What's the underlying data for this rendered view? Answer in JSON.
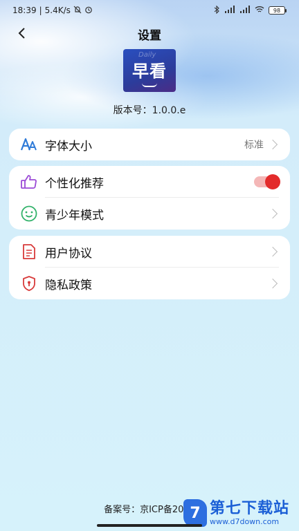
{
  "status_bar": {
    "time": "18:39",
    "speed": "5.4K/s",
    "battery": "98"
  },
  "nav": {
    "title": "设置"
  },
  "logo": {
    "small_text": "Daily",
    "name": "早看"
  },
  "version_text": "版本号：1.0.0.e",
  "settings": {
    "font_size": {
      "label": "字体大小",
      "value": "标准",
      "icon": "font-size-icon"
    },
    "personalized": {
      "label": "个性化推荐",
      "icon": "thumbs-up-icon",
      "enabled": true
    },
    "teen_mode": {
      "label": "青少年模式",
      "icon": "smile-face-icon"
    },
    "user_agreement": {
      "label": "用户协议",
      "icon": "document-icon"
    },
    "privacy_policy": {
      "label": "隐私政策",
      "icon": "shield-icon"
    }
  },
  "footer": {
    "icp": "备案号：京ICP备2022"
  },
  "watermark": {
    "title": "第七下载站",
    "url": "www.d7down.com"
  },
  "colors": {
    "accent": "#e32b2b",
    "icon_blue": "#2f7bd8",
    "icon_purple": "#9b4ad6",
    "icon_green": "#32b26a",
    "icon_red": "#d83a3a"
  }
}
